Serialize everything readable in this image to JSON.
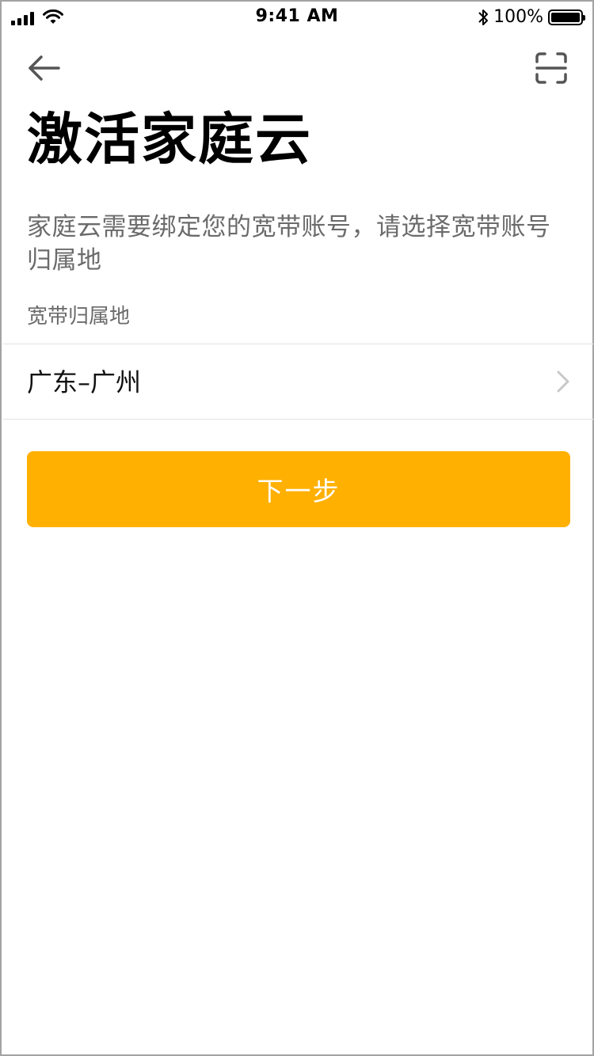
{
  "status_bar": {
    "time": "9:41 AM",
    "battery_text": "100%",
    "icons": [
      "signal-icon",
      "wifi-icon",
      "bluetooth-icon",
      "battery-icon"
    ]
  },
  "nav": {
    "back_icon": "back-arrow-icon",
    "scan_icon": "scan-icon"
  },
  "page": {
    "title": "激活家庭云",
    "description": "家庭云需要绑定您的宽带账号，请选择宽带账号归属地",
    "section_label": "宽带归属地",
    "region_value": "广东–广州",
    "next_label": "下一步"
  },
  "colors": {
    "accent": "#ffb000",
    "secondary_text": "#6b6b6b",
    "divider": "#e2e2e2"
  }
}
